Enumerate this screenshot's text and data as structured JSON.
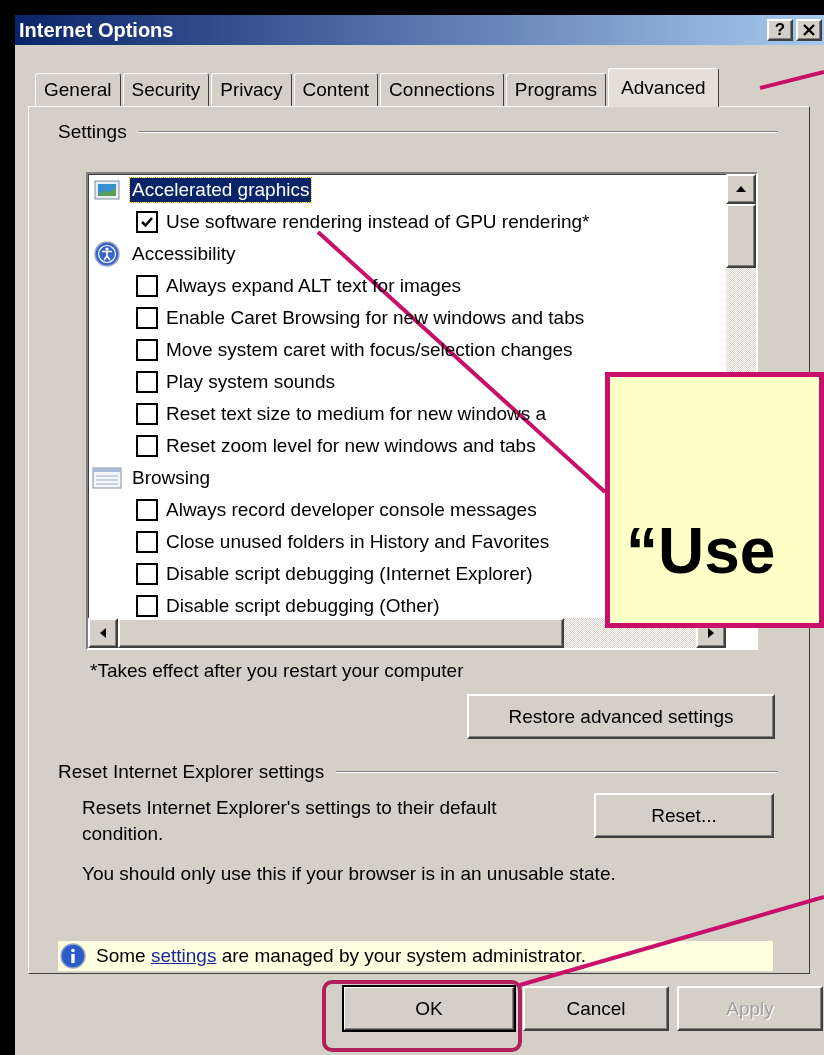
{
  "window": {
    "title": "Internet Options",
    "title_buttons": [
      "?"
    ]
  },
  "tabs": [
    {
      "label": "General",
      "selected": false
    },
    {
      "label": "Security",
      "selected": false
    },
    {
      "label": "Privacy",
      "selected": false
    },
    {
      "label": "Content",
      "selected": false
    },
    {
      "label": "Connections",
      "selected": false
    },
    {
      "label": "Programs",
      "selected": false
    },
    {
      "label": "Advanced",
      "selected": true
    }
  ],
  "settings": {
    "label": "Settings",
    "categories": [
      {
        "label": "Accelerated graphics",
        "selected": true,
        "children": [
          {
            "label": "Use software rendering instead of GPU rendering*",
            "checked": true
          }
        ]
      },
      {
        "label": "Accessibility",
        "selected": false,
        "children": [
          {
            "label": "Always expand ALT text for images",
            "checked": false
          },
          {
            "label": "Enable Caret Browsing for new windows and tabs",
            "checked": false
          },
          {
            "label": "Move system caret with focus/selection changes",
            "checked": false
          },
          {
            "label": "Play system sounds",
            "checked": false
          },
          {
            "label": "Reset text size to medium for new windows a",
            "checked": false
          },
          {
            "label": "Reset zoom level for new windows and tabs",
            "checked": false
          }
        ]
      },
      {
        "label": "Browsing",
        "selected": false,
        "children": [
          {
            "label": "Always record developer console messages",
            "checked": false
          },
          {
            "label": "Close unused folders in History and Favorites",
            "checked": false
          },
          {
            "label": "Disable script debugging (Internet Explorer)",
            "checked": false
          },
          {
            "label": "Disable script debugging (Other)",
            "checked": false
          }
        ]
      }
    ],
    "footnote": "*Takes effect after you restart your computer",
    "restore_button": "Restore advanced settings"
  },
  "reset": {
    "label": "Reset Internet Explorer settings",
    "description": "Resets Internet Explorer's settings to their default condition.",
    "button": "Reset...",
    "note": "You should only use this if your browser is in an unusable state."
  },
  "info_bar": {
    "before": "Some",
    "link": "settings",
    "after": "are managed by your system administrator."
  },
  "buttons": [
    {
      "label": "OK",
      "default": true,
      "disabled": false
    },
    {
      "label": "Cancel",
      "default": false,
      "disabled": false
    },
    {
      "label": "Apply",
      "default": false,
      "disabled": true
    }
  ],
  "annotation": {
    "callout": "“Use"
  }
}
